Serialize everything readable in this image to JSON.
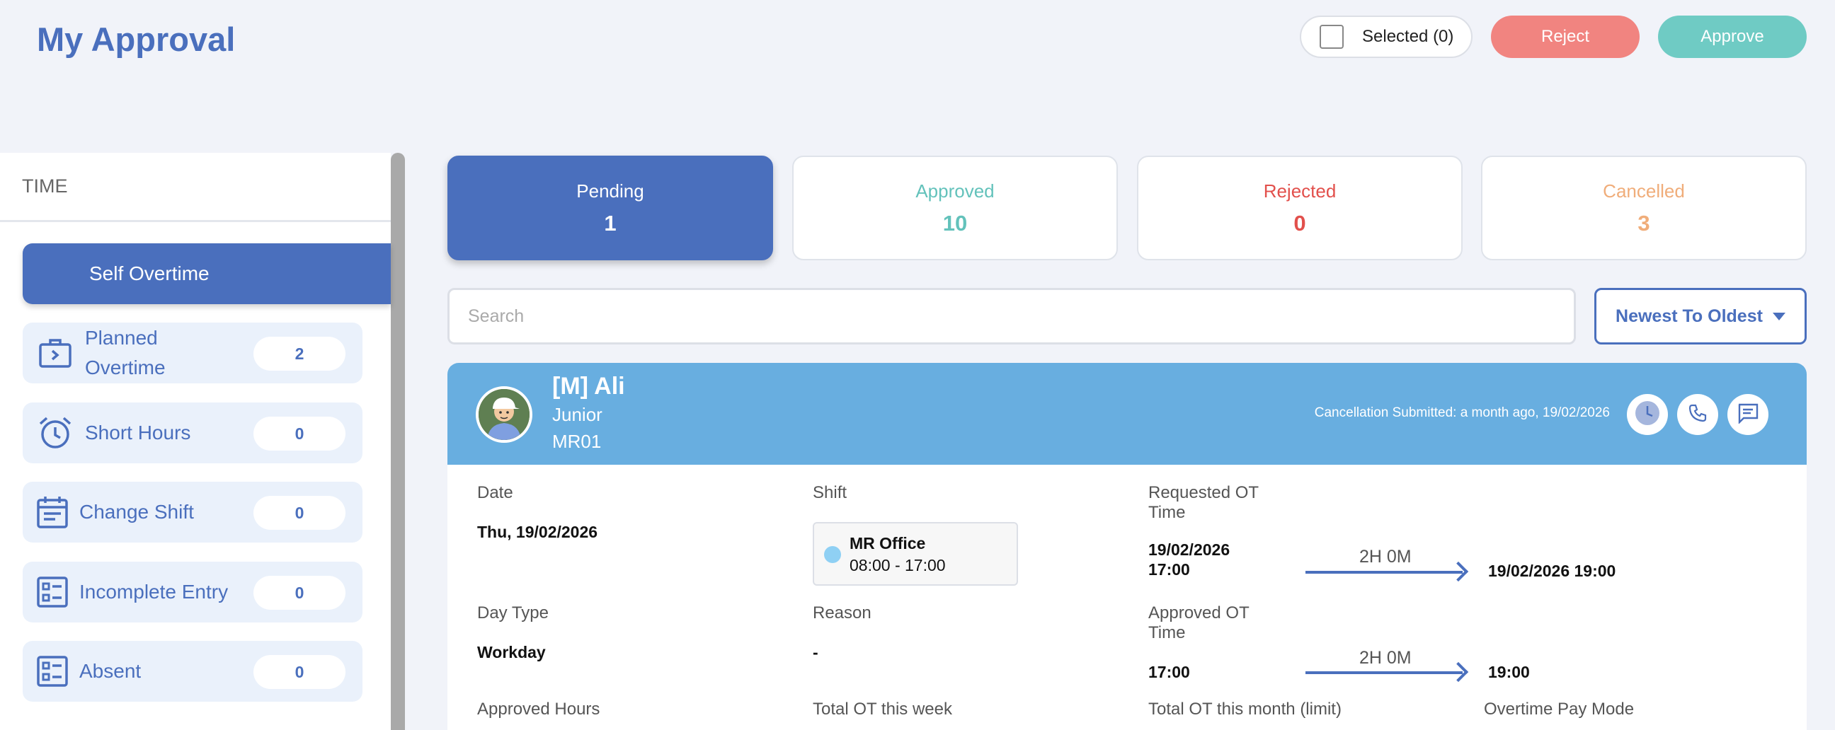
{
  "page": {
    "title": "My Approval"
  },
  "actions": {
    "selected_label": "Selected (0)",
    "reject_label": "Reject",
    "approve_label": "Approve"
  },
  "sidebar": {
    "section": "TIME",
    "items": [
      {
        "label": "Self Overtime",
        "count": ""
      },
      {
        "label": "Planned Overtime",
        "count": "2"
      },
      {
        "label": "Short Hours",
        "count": "0"
      },
      {
        "label": "Change Shift",
        "count": "0"
      },
      {
        "label": "Incomplete Entry",
        "count": "0"
      },
      {
        "label": "Absent",
        "count": "0"
      }
    ]
  },
  "tabs": [
    {
      "label": "Pending",
      "count": "1"
    },
    {
      "label": "Approved",
      "count": "10"
    },
    {
      "label": "Rejected",
      "count": "0"
    },
    {
      "label": "Cancelled",
      "count": "3"
    }
  ],
  "search": {
    "placeholder": "Search",
    "value": ""
  },
  "sort": {
    "label": "Newest To Oldest"
  },
  "card": {
    "name": "[M] Ali",
    "role": "Junior",
    "code": "MR01",
    "status_note": "Cancellation Submitted: a month ago, 19/02/2026",
    "date_label": "Date",
    "date_value": "Thu, 19/02/2026",
    "shift_label": "Shift",
    "shift_name": "MR Office",
    "shift_time": "08:00 - 17:00",
    "req_ot_label": "Requested OT Time",
    "req_ot_start": "19/02/2026 17:00",
    "req_ot_duration": "2H 0M",
    "req_ot_end": "19/02/2026 19:00",
    "day_type_label": "Day Type",
    "day_type_value": "Workday",
    "reason_label": "Reason",
    "reason_value": "-",
    "appr_ot_label": "Approved OT Time",
    "appr_ot_start": "17:00",
    "appr_ot_duration": "2H 0M",
    "appr_ot_end": "19:00",
    "approved_hours_label": "Approved Hours",
    "total_week_label": "Total OT this week",
    "total_month_label": "Total OT this month (limit)",
    "pay_mode_label": "Overtime Pay Mode"
  },
  "colors": {
    "primary": "#4a6fbd",
    "header_bar": "#68aee0",
    "reject": "#f18480",
    "approve": "#6fcbc4"
  }
}
